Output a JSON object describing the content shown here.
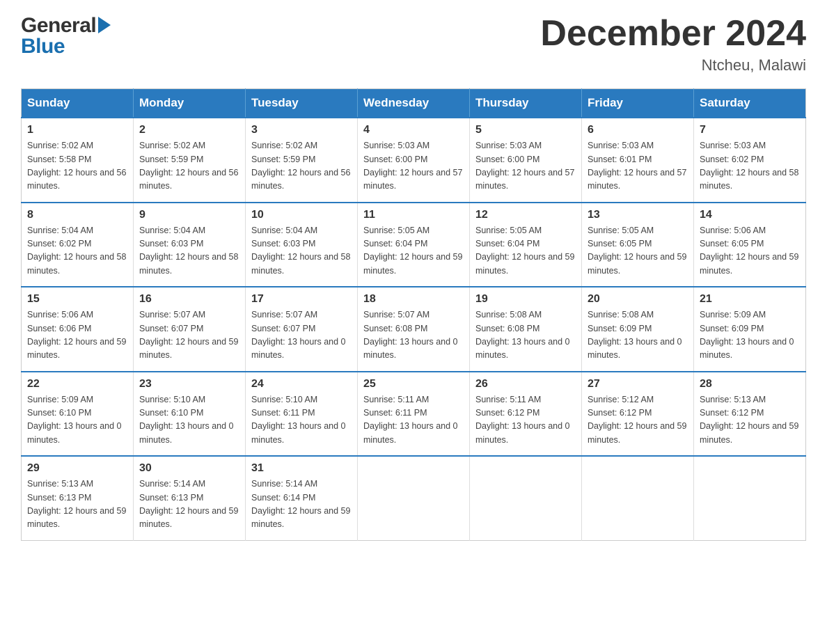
{
  "header": {
    "logo_general": "General",
    "logo_blue": "Blue",
    "month_title": "December 2024",
    "location": "Ntcheu, Malawi"
  },
  "calendar": {
    "days_of_week": [
      "Sunday",
      "Monday",
      "Tuesday",
      "Wednesday",
      "Thursday",
      "Friday",
      "Saturday"
    ],
    "weeks": [
      [
        {
          "day": "1",
          "sunrise": "5:02 AM",
          "sunset": "5:58 PM",
          "daylight": "12 hours and 56 minutes."
        },
        {
          "day": "2",
          "sunrise": "5:02 AM",
          "sunset": "5:59 PM",
          "daylight": "12 hours and 56 minutes."
        },
        {
          "day": "3",
          "sunrise": "5:02 AM",
          "sunset": "5:59 PM",
          "daylight": "12 hours and 56 minutes."
        },
        {
          "day": "4",
          "sunrise": "5:03 AM",
          "sunset": "6:00 PM",
          "daylight": "12 hours and 57 minutes."
        },
        {
          "day": "5",
          "sunrise": "5:03 AM",
          "sunset": "6:00 PM",
          "daylight": "12 hours and 57 minutes."
        },
        {
          "day": "6",
          "sunrise": "5:03 AM",
          "sunset": "6:01 PM",
          "daylight": "12 hours and 57 minutes."
        },
        {
          "day": "7",
          "sunrise": "5:03 AM",
          "sunset": "6:02 PM",
          "daylight": "12 hours and 58 minutes."
        }
      ],
      [
        {
          "day": "8",
          "sunrise": "5:04 AM",
          "sunset": "6:02 PM",
          "daylight": "12 hours and 58 minutes."
        },
        {
          "day": "9",
          "sunrise": "5:04 AM",
          "sunset": "6:03 PM",
          "daylight": "12 hours and 58 minutes."
        },
        {
          "day": "10",
          "sunrise": "5:04 AM",
          "sunset": "6:03 PM",
          "daylight": "12 hours and 58 minutes."
        },
        {
          "day": "11",
          "sunrise": "5:05 AM",
          "sunset": "6:04 PM",
          "daylight": "12 hours and 59 minutes."
        },
        {
          "day": "12",
          "sunrise": "5:05 AM",
          "sunset": "6:04 PM",
          "daylight": "12 hours and 59 minutes."
        },
        {
          "day": "13",
          "sunrise": "5:05 AM",
          "sunset": "6:05 PM",
          "daylight": "12 hours and 59 minutes."
        },
        {
          "day": "14",
          "sunrise": "5:06 AM",
          "sunset": "6:05 PM",
          "daylight": "12 hours and 59 minutes."
        }
      ],
      [
        {
          "day": "15",
          "sunrise": "5:06 AM",
          "sunset": "6:06 PM",
          "daylight": "12 hours and 59 minutes."
        },
        {
          "day": "16",
          "sunrise": "5:07 AM",
          "sunset": "6:07 PM",
          "daylight": "12 hours and 59 minutes."
        },
        {
          "day": "17",
          "sunrise": "5:07 AM",
          "sunset": "6:07 PM",
          "daylight": "13 hours and 0 minutes."
        },
        {
          "day": "18",
          "sunrise": "5:07 AM",
          "sunset": "6:08 PM",
          "daylight": "13 hours and 0 minutes."
        },
        {
          "day": "19",
          "sunrise": "5:08 AM",
          "sunset": "6:08 PM",
          "daylight": "13 hours and 0 minutes."
        },
        {
          "day": "20",
          "sunrise": "5:08 AM",
          "sunset": "6:09 PM",
          "daylight": "13 hours and 0 minutes."
        },
        {
          "day": "21",
          "sunrise": "5:09 AM",
          "sunset": "6:09 PM",
          "daylight": "13 hours and 0 minutes."
        }
      ],
      [
        {
          "day": "22",
          "sunrise": "5:09 AM",
          "sunset": "6:10 PM",
          "daylight": "13 hours and 0 minutes."
        },
        {
          "day": "23",
          "sunrise": "5:10 AM",
          "sunset": "6:10 PM",
          "daylight": "13 hours and 0 minutes."
        },
        {
          "day": "24",
          "sunrise": "5:10 AM",
          "sunset": "6:11 PM",
          "daylight": "13 hours and 0 minutes."
        },
        {
          "day": "25",
          "sunrise": "5:11 AM",
          "sunset": "6:11 PM",
          "daylight": "13 hours and 0 minutes."
        },
        {
          "day": "26",
          "sunrise": "5:11 AM",
          "sunset": "6:12 PM",
          "daylight": "13 hours and 0 minutes."
        },
        {
          "day": "27",
          "sunrise": "5:12 AM",
          "sunset": "6:12 PM",
          "daylight": "12 hours and 59 minutes."
        },
        {
          "day": "28",
          "sunrise": "5:13 AM",
          "sunset": "6:12 PM",
          "daylight": "12 hours and 59 minutes."
        }
      ],
      [
        {
          "day": "29",
          "sunrise": "5:13 AM",
          "sunset": "6:13 PM",
          "daylight": "12 hours and 59 minutes."
        },
        {
          "day": "30",
          "sunrise": "5:14 AM",
          "sunset": "6:13 PM",
          "daylight": "12 hours and 59 minutes."
        },
        {
          "day": "31",
          "sunrise": "5:14 AM",
          "sunset": "6:14 PM",
          "daylight": "12 hours and 59 minutes."
        },
        null,
        null,
        null,
        null
      ]
    ]
  }
}
